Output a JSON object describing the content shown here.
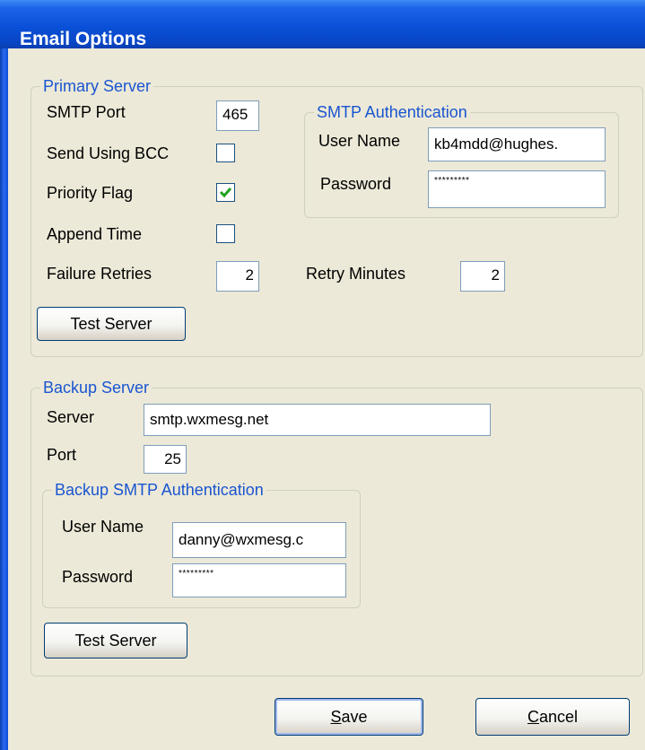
{
  "window": {
    "title": "Email Options"
  },
  "primary": {
    "group_label": "Primary Server",
    "smtp_port_label": "SMTP Port",
    "smtp_port_value": "465",
    "bcc_label": "Send Using BCC",
    "bcc_checked": false,
    "priority_label": "Priority Flag",
    "priority_checked": true,
    "append_label": "Append Time",
    "append_checked": false,
    "retries_label": "Failure Retries",
    "retries_value": "2",
    "retry_minutes_label": "Retry Minutes",
    "retry_minutes_value": "2",
    "test_button": "Test Server",
    "auth": {
      "group_label": "SMTP Authentication",
      "user_label": "User Name",
      "user_value": "kb4mdd@hughes.",
      "pass_label": "Password",
      "pass_value": "*********"
    }
  },
  "backup": {
    "group_label": "Backup Server",
    "server_label": "Server",
    "server_value": "smtp.wxmesg.net",
    "port_label": "Port",
    "port_value": "25",
    "test_button": "Test Server",
    "auth": {
      "group_label": "Backup SMTP Authentication",
      "user_label": "User Name",
      "user_value": "danny@wxmesg.c",
      "pass_label": "Password",
      "pass_value": "*********"
    }
  },
  "footer": {
    "save_mnemonic": "S",
    "save_rest": "ave",
    "cancel_mnemonic": "C",
    "cancel_rest": "ancel"
  },
  "colors": {
    "groupbox_title": "#1a55d0",
    "checkmark": "#21a121",
    "titlebar": "#0a50d8"
  }
}
